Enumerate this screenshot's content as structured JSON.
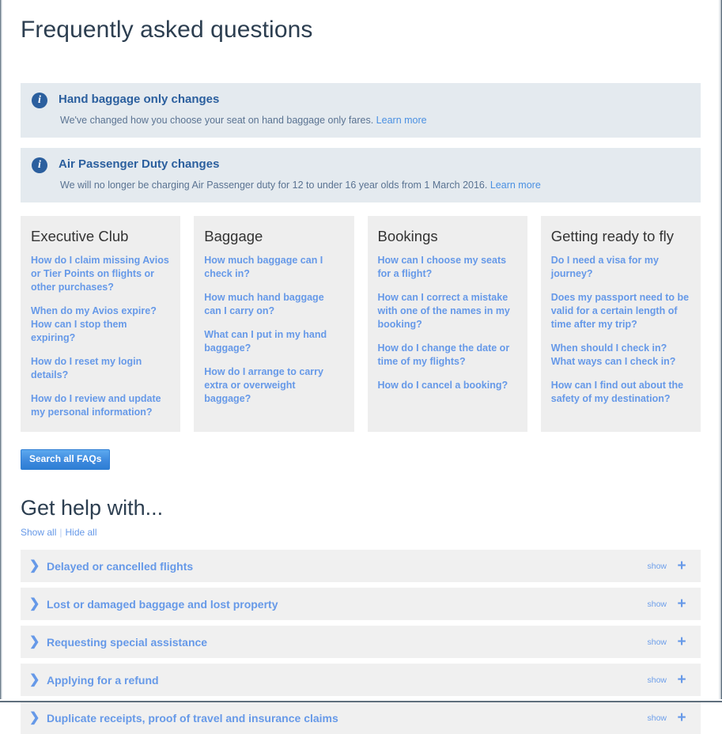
{
  "header": {
    "title": "Frequently asked questions"
  },
  "banners": [
    {
      "icon": "info-icon",
      "title": "Hand baggage only changes",
      "text": "We've changed how you choose your seat on hand baggage only fares.",
      "link": "Learn more"
    },
    {
      "icon": "info-icon",
      "title": "Air Passenger Duty changes",
      "text": "We will no longer be charging Air Passenger duty for 12 to under 16 year olds from 1 March 2016.",
      "link": "Learn more"
    }
  ],
  "categories": [
    {
      "title": "Executive Club",
      "questions": [
        "How do I claim missing Avios or Tier Points on flights or other purchases?",
        "When do my Avios expire? How can I stop them expiring?",
        "How do I reset my login details?",
        "How do I review and update my personal information?"
      ]
    },
    {
      "title": "Baggage",
      "questions": [
        "How much baggage can I check in?",
        "How much hand baggage can I carry on?",
        "What can I put in my hand baggage?",
        "How do I arrange to carry extra or overweight baggage?"
      ]
    },
    {
      "title": "Bookings",
      "questions": [
        "How can I choose my seats for a flight?",
        "How can I correct a mistake with one of the names in my booking?",
        "How do I change the date or time of my flights?",
        "How do I cancel a booking?"
      ]
    },
    {
      "title": "Getting ready to fly",
      "questions": [
        "Do I need a visa for my journey?",
        "Does my passport need to be valid for a certain length of time after my trip?",
        "When should I check in? What ways can I check in?",
        "How can I find out about the safety of my destination?"
      ]
    }
  ],
  "search_button": {
    "label": "Search all FAQs"
  },
  "help_section": {
    "title": "Get help with...",
    "show_all": "Show all",
    "separator": "|",
    "hide_all": "Hide all",
    "show_label": "show",
    "plus_glyph": "+",
    "chevron_glyph": "❯",
    "items": [
      {
        "label": "Delayed or cancelled flights"
      },
      {
        "label": "Lost or damaged baggage and lost property"
      },
      {
        "label": "Requesting special assistance"
      },
      {
        "label": "Applying for a refund"
      },
      {
        "label": "Duplicate receipts, proof of travel and insurance claims"
      }
    ]
  },
  "colors": {
    "accent_blue": "#6699e8",
    "banner_bg": "#e4eaef",
    "banner_title": "#2b5f9e",
    "card_bg": "#eeeeee",
    "accordion_bg": "#f0f0f0",
    "heading": "#2c3e50",
    "button_blue": "#3e8ade"
  }
}
